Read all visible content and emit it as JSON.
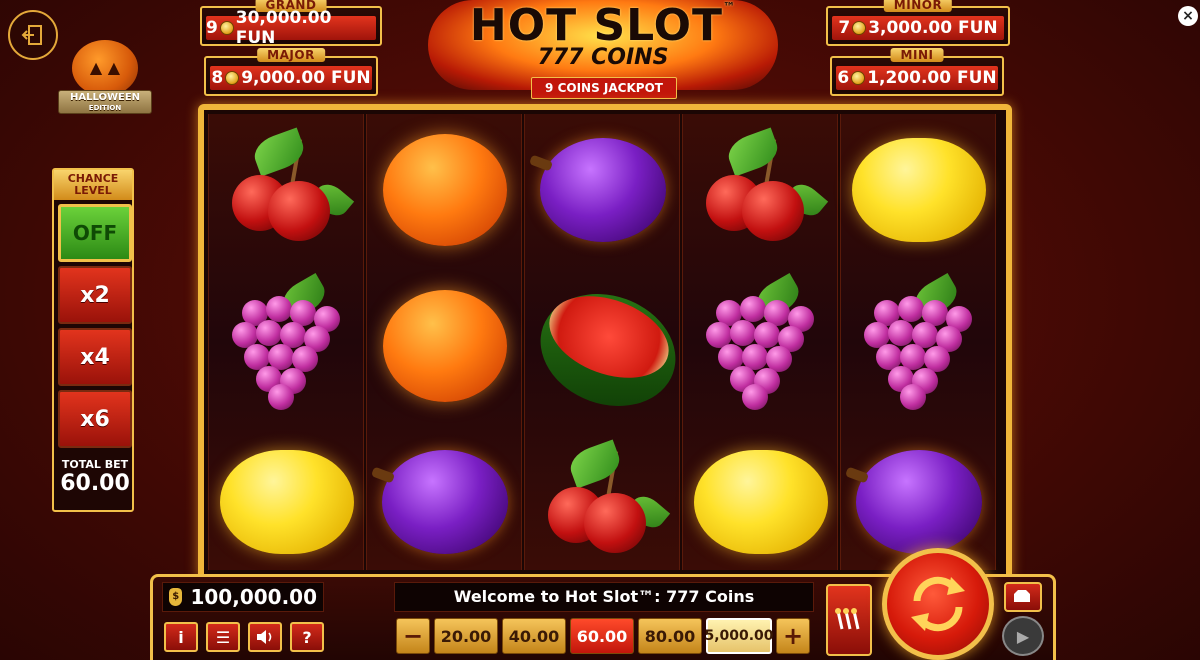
{
  "halloween_badge": {
    "line1": "HALLOWEEN",
    "line2": "EDITION"
  },
  "jackpots": {
    "grand": {
      "label": "GRAND",
      "count": "9",
      "amount": "30,000.00 FUN"
    },
    "major": {
      "label": "MAJOR",
      "count": "8",
      "amount": "9,000.00 FUN"
    },
    "minor": {
      "label": "MINOR",
      "count": "7",
      "amount": "3,000.00 FUN"
    },
    "mini": {
      "label": "MINI",
      "count": "6",
      "amount": "1,200.00 FUN"
    }
  },
  "logo": {
    "title": "HOT SLOT",
    "trademark": "™",
    "subtitle": "777 COINS",
    "tag": "9 COINS JACKPOT"
  },
  "reels": [
    [
      "cherries",
      "grapes",
      "lemon"
    ],
    [
      "orange",
      "orange",
      "plum"
    ],
    [
      "plum",
      "watermelon",
      "cherries"
    ],
    [
      "cherries",
      "grapes",
      "lemon"
    ],
    [
      "lemon",
      "grapes",
      "plum"
    ]
  ],
  "chance_level": {
    "title_line1": "CHANCE",
    "title_line2": "LEVEL",
    "off_label": "OFF",
    "options": [
      "x2",
      "x4",
      "x6"
    ]
  },
  "total_bet": {
    "label": "TOTAL BET",
    "value": "60.00"
  },
  "balance": "100,000.00",
  "message": "Welcome to Hot Slot™: 777 Coins",
  "bet_options": [
    "20.00",
    "40.00",
    "60.00",
    "80.00",
    "5,000.00"
  ],
  "selected_bet": "60.00",
  "controls": {
    "info": "i",
    "menu": "☰",
    "sound": "🔊",
    "help": "?",
    "minus": "−",
    "plus": "+"
  },
  "colors": {
    "gold": "#f2c04a",
    "red": "#d61a0a",
    "background": "#4a0a05",
    "off_green": "#6bd13a"
  }
}
